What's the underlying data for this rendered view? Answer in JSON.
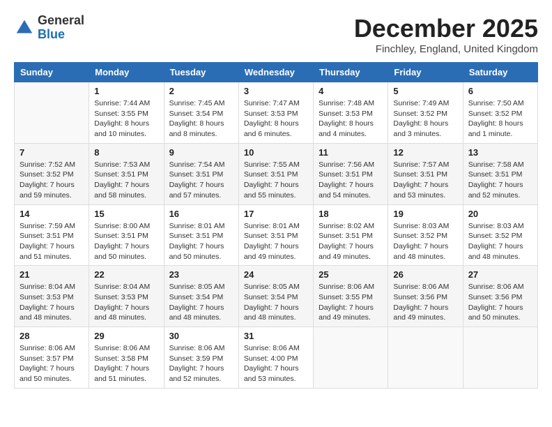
{
  "logo": {
    "general": "General",
    "blue": "Blue"
  },
  "title": "December 2025",
  "location": "Finchley, England, United Kingdom",
  "days_of_week": [
    "Sunday",
    "Monday",
    "Tuesday",
    "Wednesday",
    "Thursday",
    "Friday",
    "Saturday"
  ],
  "weeks": [
    [
      {
        "day": "",
        "info": ""
      },
      {
        "day": "1",
        "info": "Sunrise: 7:44 AM\nSunset: 3:55 PM\nDaylight: 8 hours\nand 10 minutes."
      },
      {
        "day": "2",
        "info": "Sunrise: 7:45 AM\nSunset: 3:54 PM\nDaylight: 8 hours\nand 8 minutes."
      },
      {
        "day": "3",
        "info": "Sunrise: 7:47 AM\nSunset: 3:53 PM\nDaylight: 8 hours\nand 6 minutes."
      },
      {
        "day": "4",
        "info": "Sunrise: 7:48 AM\nSunset: 3:53 PM\nDaylight: 8 hours\nand 4 minutes."
      },
      {
        "day": "5",
        "info": "Sunrise: 7:49 AM\nSunset: 3:52 PM\nDaylight: 8 hours\nand 3 minutes."
      },
      {
        "day": "6",
        "info": "Sunrise: 7:50 AM\nSunset: 3:52 PM\nDaylight: 8 hours\nand 1 minute."
      }
    ],
    [
      {
        "day": "7",
        "info": "Sunrise: 7:52 AM\nSunset: 3:52 PM\nDaylight: 7 hours\nand 59 minutes."
      },
      {
        "day": "8",
        "info": "Sunrise: 7:53 AM\nSunset: 3:51 PM\nDaylight: 7 hours\nand 58 minutes."
      },
      {
        "day": "9",
        "info": "Sunrise: 7:54 AM\nSunset: 3:51 PM\nDaylight: 7 hours\nand 57 minutes."
      },
      {
        "day": "10",
        "info": "Sunrise: 7:55 AM\nSunset: 3:51 PM\nDaylight: 7 hours\nand 55 minutes."
      },
      {
        "day": "11",
        "info": "Sunrise: 7:56 AM\nSunset: 3:51 PM\nDaylight: 7 hours\nand 54 minutes."
      },
      {
        "day": "12",
        "info": "Sunrise: 7:57 AM\nSunset: 3:51 PM\nDaylight: 7 hours\nand 53 minutes."
      },
      {
        "day": "13",
        "info": "Sunrise: 7:58 AM\nSunset: 3:51 PM\nDaylight: 7 hours\nand 52 minutes."
      }
    ],
    [
      {
        "day": "14",
        "info": "Sunrise: 7:59 AM\nSunset: 3:51 PM\nDaylight: 7 hours\nand 51 minutes."
      },
      {
        "day": "15",
        "info": "Sunrise: 8:00 AM\nSunset: 3:51 PM\nDaylight: 7 hours\nand 50 minutes."
      },
      {
        "day": "16",
        "info": "Sunrise: 8:01 AM\nSunset: 3:51 PM\nDaylight: 7 hours\nand 50 minutes."
      },
      {
        "day": "17",
        "info": "Sunrise: 8:01 AM\nSunset: 3:51 PM\nDaylight: 7 hours\nand 49 minutes."
      },
      {
        "day": "18",
        "info": "Sunrise: 8:02 AM\nSunset: 3:51 PM\nDaylight: 7 hours\nand 49 minutes."
      },
      {
        "day": "19",
        "info": "Sunrise: 8:03 AM\nSunset: 3:52 PM\nDaylight: 7 hours\nand 48 minutes."
      },
      {
        "day": "20",
        "info": "Sunrise: 8:03 AM\nSunset: 3:52 PM\nDaylight: 7 hours\nand 48 minutes."
      }
    ],
    [
      {
        "day": "21",
        "info": "Sunrise: 8:04 AM\nSunset: 3:53 PM\nDaylight: 7 hours\nand 48 minutes."
      },
      {
        "day": "22",
        "info": "Sunrise: 8:04 AM\nSunset: 3:53 PM\nDaylight: 7 hours\nand 48 minutes."
      },
      {
        "day": "23",
        "info": "Sunrise: 8:05 AM\nSunset: 3:54 PM\nDaylight: 7 hours\nand 48 minutes."
      },
      {
        "day": "24",
        "info": "Sunrise: 8:05 AM\nSunset: 3:54 PM\nDaylight: 7 hours\nand 48 minutes."
      },
      {
        "day": "25",
        "info": "Sunrise: 8:06 AM\nSunset: 3:55 PM\nDaylight: 7 hours\nand 49 minutes."
      },
      {
        "day": "26",
        "info": "Sunrise: 8:06 AM\nSunset: 3:56 PM\nDaylight: 7 hours\nand 49 minutes."
      },
      {
        "day": "27",
        "info": "Sunrise: 8:06 AM\nSunset: 3:56 PM\nDaylight: 7 hours\nand 50 minutes."
      }
    ],
    [
      {
        "day": "28",
        "info": "Sunrise: 8:06 AM\nSunset: 3:57 PM\nDaylight: 7 hours\nand 50 minutes."
      },
      {
        "day": "29",
        "info": "Sunrise: 8:06 AM\nSunset: 3:58 PM\nDaylight: 7 hours\nand 51 minutes."
      },
      {
        "day": "30",
        "info": "Sunrise: 8:06 AM\nSunset: 3:59 PM\nDaylight: 7 hours\nand 52 minutes."
      },
      {
        "day": "31",
        "info": "Sunrise: 8:06 AM\nSunset: 4:00 PM\nDaylight: 7 hours\nand 53 minutes."
      },
      {
        "day": "",
        "info": ""
      },
      {
        "day": "",
        "info": ""
      },
      {
        "day": "",
        "info": ""
      }
    ]
  ]
}
